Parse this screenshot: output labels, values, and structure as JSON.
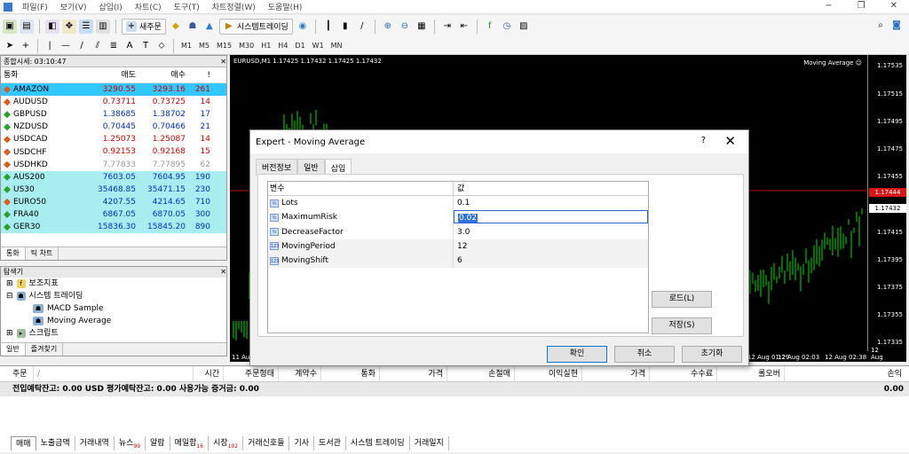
{
  "menu": {
    "items": [
      "파일(F)",
      "보기(V)",
      "삽입(I)",
      "차트(C)",
      "도구(T)",
      "차트정렬(W)",
      "도움말(H)"
    ]
  },
  "toolbar": {
    "new_order": "새주문",
    "algo_trading": "시스템트레이딩",
    "timeframes": [
      "M1",
      "M5",
      "M15",
      "M30",
      "H1",
      "H4",
      "D1",
      "W1",
      "MN"
    ]
  },
  "market_watch": {
    "title": "종합시세: 03:10:47",
    "columns": [
      "통화",
      "매도",
      "매수",
      "!"
    ],
    "rows": [
      {
        "symbol": "AMAZON",
        "bid": "3290.55",
        "ask": "3293.16",
        "spread": "261"
      },
      {
        "symbol": "AUDUSD",
        "bid": "0.73711",
        "ask": "0.73725",
        "spread": "14"
      },
      {
        "symbol": "GBPUSD",
        "bid": "1.38685",
        "ask": "1.38702",
        "spread": "17"
      },
      {
        "symbol": "NZDUSD",
        "bid": "0.70445",
        "ask": "0.70466",
        "spread": "21"
      },
      {
        "symbol": "USDCAD",
        "bid": "1.25073",
        "ask": "1.25087",
        "spread": "14"
      },
      {
        "symbol": "USDCHF",
        "bid": "0.92153",
        "ask": "0.92168",
        "spread": "15"
      },
      {
        "symbol": "USDHKD",
        "bid": "7.77833",
        "ask": "7.77895",
        "spread": "62"
      },
      {
        "symbol": "AUS200",
        "bid": "7603.05",
        "ask": "7604.95",
        "spread": "190"
      },
      {
        "symbol": "US30",
        "bid": "35468.85",
        "ask": "35471.15",
        "spread": "230"
      },
      {
        "symbol": "EURO50",
        "bid": "4207.55",
        "ask": "4214.65",
        "spread": "710"
      },
      {
        "symbol": "FRA40",
        "bid": "6867.05",
        "ask": "6870.05",
        "spread": "300"
      },
      {
        "symbol": "GER30",
        "bid": "15836.30",
        "ask": "15845.20",
        "spread": "890"
      }
    ],
    "tabs": [
      "통화",
      "틱 차트"
    ]
  },
  "navigator": {
    "title": "탐색기",
    "items": [
      "보조지표",
      "시스템 트레이딩",
      "MACD Sample",
      "Moving Average",
      "스크립트"
    ],
    "tabs": [
      "일반",
      "즐겨찾기"
    ]
  },
  "chart": {
    "title": "EURUSD,M1  1.17425 1.17432 1.17425 1.17432",
    "indicator": "Moving Average ☺",
    "prices": [
      "1.17535",
      "1.17515",
      "1.17495",
      "1.17475",
      "1.17455",
      "1.17444",
      "1.17432",
      "1.17415",
      "1.17395",
      "1.17375",
      "1.17355",
      "1.17335"
    ],
    "time_labels": [
      "11 Aug",
      "12 Aug 01:29",
      "12 Aug 02:03",
      "12 Aug 02:38",
      "12 Aug"
    ]
  },
  "dialog": {
    "title": "Expert - Moving Average",
    "help": "?",
    "tabs": [
      "버전정보",
      "일반",
      "삽입"
    ],
    "columns": [
      "변수",
      "값"
    ],
    "params": [
      {
        "type": "½",
        "name": "Lots",
        "value": "0.1"
      },
      {
        "type": "½",
        "name": "MaximumRisk",
        "value": "0.02"
      },
      {
        "type": "½",
        "name": "DecreaseFactor",
        "value": "3.0"
      },
      {
        "type": "123",
        "name": "MovingPeriod",
        "value": "12"
      },
      {
        "type": "123",
        "name": "MovingShift",
        "value": "6"
      }
    ],
    "load": "로드(L)",
    "save": "저장(S)",
    "ok": "확인",
    "cancel": "취소",
    "reset": "초기화"
  },
  "terminal": {
    "columns": [
      "주문",
      "/",
      "시간",
      "주문형태",
      "계약수",
      "통화",
      "가격",
      "손절매",
      "이익실현",
      "가격",
      "수수료",
      "롤오버",
      "손익"
    ],
    "summary": "전입예탁잔고: 0.00 USD  평가예탁잔고: 0.00  사용가능 증거금: 0.00",
    "total": "0.00",
    "tabs": [
      {
        "label": "매매",
        "badge": ""
      },
      {
        "label": "노출금액",
        "badge": ""
      },
      {
        "label": "거래내역",
        "badge": ""
      },
      {
        "label": "뉴스",
        "badge": "99"
      },
      {
        "label": "알람",
        "badge": ""
      },
      {
        "label": "메일함",
        "badge": "16"
      },
      {
        "label": "시장",
        "badge": "102"
      },
      {
        "label": "거래신호들",
        "badge": ""
      },
      {
        "label": "기사",
        "badge": ""
      },
      {
        "label": "도서관",
        "badge": ""
      },
      {
        "label": "시스템 트레이딩",
        "badge": ""
      },
      {
        "label": "거래일지",
        "badge": ""
      }
    ]
  }
}
